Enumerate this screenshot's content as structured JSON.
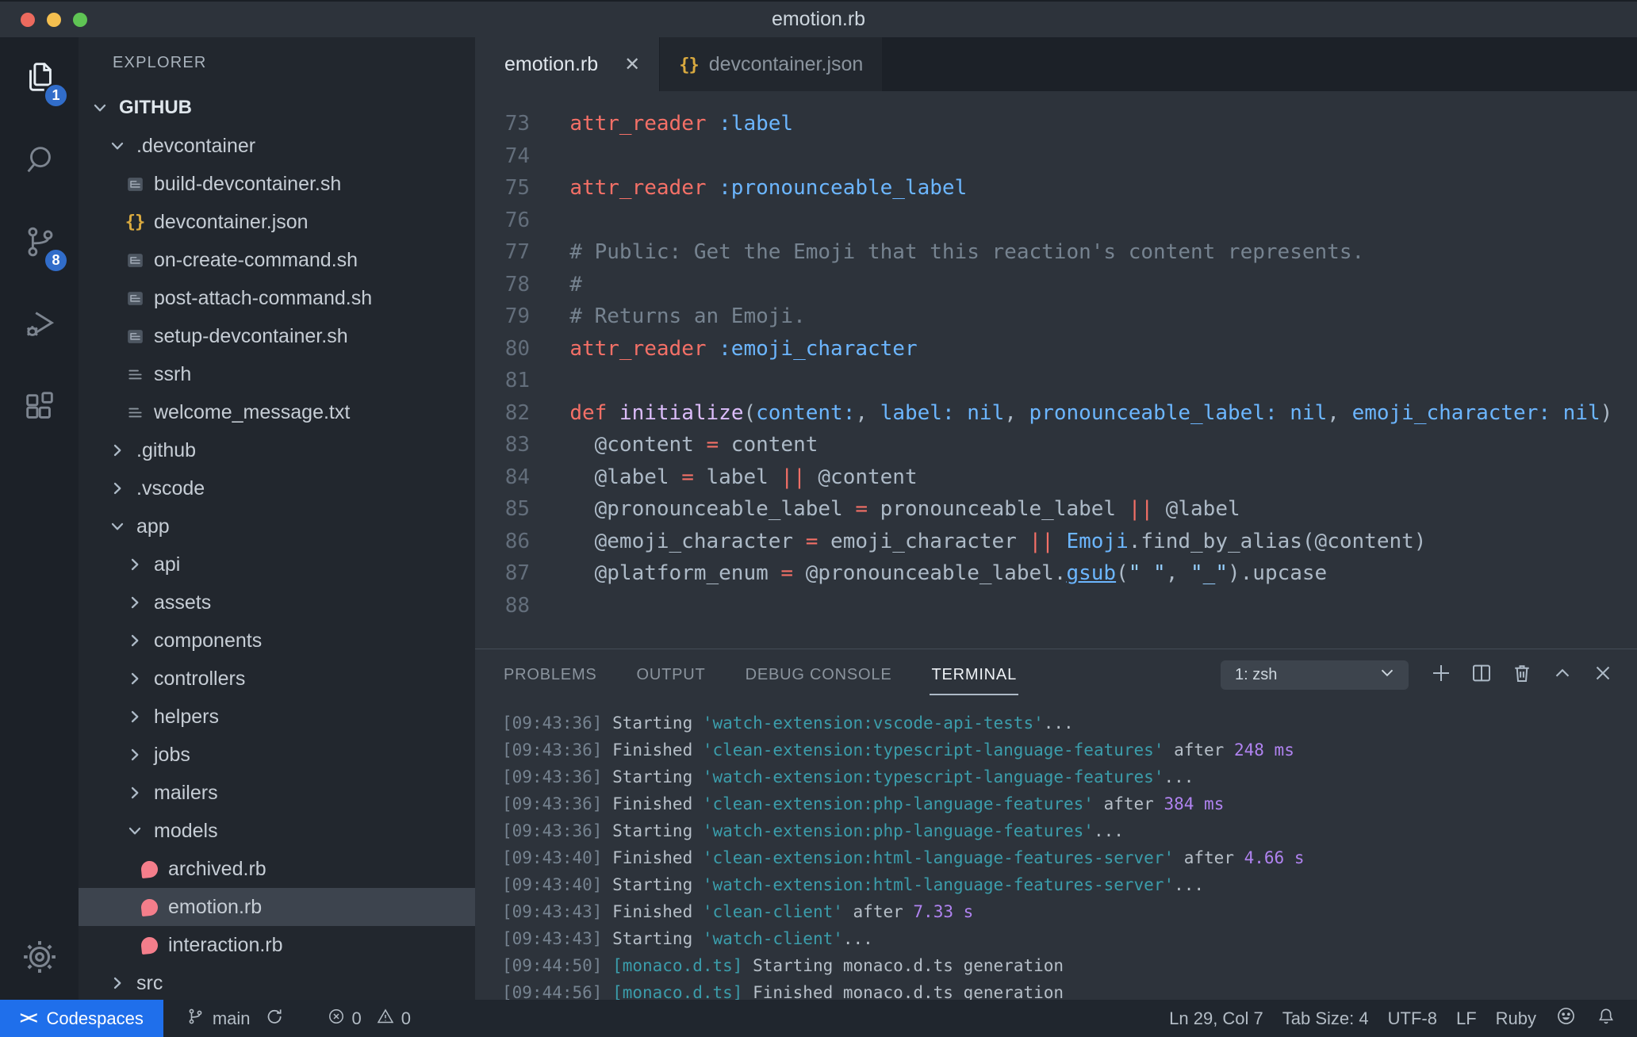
{
  "window": {
    "title": "emotion.rb"
  },
  "icons": {
    "tab_close": "✕",
    "remote_indicator": "><"
  },
  "activity_bar": {
    "items": [
      {
        "id": "explorer",
        "badge": "1",
        "active": true
      },
      {
        "id": "search",
        "badge": "",
        "active": false
      },
      {
        "id": "source-control",
        "badge": "8",
        "active": false
      },
      {
        "id": "run-debug",
        "badge": "",
        "active": false
      },
      {
        "id": "extensions",
        "badge": "",
        "active": false
      }
    ]
  },
  "sidebar": {
    "title": "EXPLORER",
    "tree": [
      {
        "label": "GITHUB",
        "level": 0,
        "kind": "folder",
        "expanded": true,
        "root": true
      },
      {
        "label": ".devcontainer",
        "level": 1,
        "kind": "folder",
        "expanded": true
      },
      {
        "label": "build-devcontainer.sh",
        "level": 2,
        "kind": "shell"
      },
      {
        "label": "devcontainer.json",
        "level": 2,
        "kind": "json"
      },
      {
        "label": "on-create-command.sh",
        "level": 2,
        "kind": "shell"
      },
      {
        "label": "post-attach-command.sh",
        "level": 2,
        "kind": "shell"
      },
      {
        "label": "setup-devcontainer.sh",
        "level": 2,
        "kind": "shell"
      },
      {
        "label": "ssrh",
        "level": 2,
        "kind": "text"
      },
      {
        "label": "welcome_message.txt",
        "level": 2,
        "kind": "text"
      },
      {
        "label": ".github",
        "level": 1,
        "kind": "folder",
        "expanded": false
      },
      {
        "label": ".vscode",
        "level": 1,
        "kind": "folder",
        "expanded": false
      },
      {
        "label": "app",
        "level": 1,
        "kind": "folder",
        "expanded": true
      },
      {
        "label": "api",
        "level": 2,
        "kind": "folder",
        "expanded": false
      },
      {
        "label": "assets",
        "level": 2,
        "kind": "folder",
        "expanded": false
      },
      {
        "label": "components",
        "level": 2,
        "kind": "folder",
        "expanded": false
      },
      {
        "label": "controllers",
        "level": 2,
        "kind": "folder",
        "expanded": false
      },
      {
        "label": "helpers",
        "level": 2,
        "kind": "folder",
        "expanded": false
      },
      {
        "label": "jobs",
        "level": 2,
        "kind": "folder",
        "expanded": false
      },
      {
        "label": "mailers",
        "level": 2,
        "kind": "folder",
        "expanded": false
      },
      {
        "label": "models",
        "level": 2,
        "kind": "folder",
        "expanded": true
      },
      {
        "label": "archived.rb",
        "level": 3,
        "kind": "ruby"
      },
      {
        "label": "emotion.rb",
        "level": 3,
        "kind": "ruby",
        "selected": true
      },
      {
        "label": "interaction.rb",
        "level": 3,
        "kind": "ruby"
      },
      {
        "label": "src",
        "level": 1,
        "kind": "folder",
        "expanded": false
      }
    ]
  },
  "editor": {
    "tabs": [
      {
        "label": "emotion.rb",
        "icon": "ruby-file-icon",
        "active": true,
        "close": "✕"
      },
      {
        "label": "devcontainer.json",
        "icon": "json-file-icon",
        "active": false
      }
    ],
    "lines": [
      {
        "num": "73",
        "segs": [
          [
            "  ",
            "plain"
          ],
          [
            "attr_reader",
            "red"
          ],
          [
            " ",
            "plain"
          ],
          [
            ":label",
            "blue"
          ]
        ]
      },
      {
        "num": "74",
        "segs": []
      },
      {
        "num": "75",
        "segs": [
          [
            "  ",
            "plain"
          ],
          [
            "attr_reader",
            "red"
          ],
          [
            " ",
            "plain"
          ],
          [
            ":pronounceable_label",
            "blue"
          ]
        ]
      },
      {
        "num": "76",
        "segs": []
      },
      {
        "num": "77",
        "segs": [
          [
            "  # Public: Get the Emoji that this reaction's content represents.",
            "comment"
          ]
        ]
      },
      {
        "num": "78",
        "segs": [
          [
            "  #",
            "comment"
          ]
        ]
      },
      {
        "num": "79",
        "segs": [
          [
            "  # Returns an Emoji.",
            "comment"
          ]
        ]
      },
      {
        "num": "80",
        "segs": [
          [
            "  ",
            "plain"
          ],
          [
            "attr_reader",
            "red"
          ],
          [
            " ",
            "plain"
          ],
          [
            ":emoji_character",
            "blue"
          ]
        ]
      },
      {
        "num": "81",
        "segs": []
      },
      {
        "num": "82",
        "segs": [
          [
            "  ",
            "plain"
          ],
          [
            "def",
            "red"
          ],
          [
            " ",
            "plain"
          ],
          [
            "initialize",
            "purple"
          ],
          [
            "(",
            "plain"
          ],
          [
            "content:",
            "blue"
          ],
          [
            ", ",
            "plain"
          ],
          [
            "label:",
            "blue"
          ],
          [
            " ",
            "plain"
          ],
          [
            "nil",
            "blue"
          ],
          [
            ", ",
            "plain"
          ],
          [
            "pronounceable_label:",
            "blue"
          ],
          [
            " ",
            "plain"
          ],
          [
            "nil",
            "blue"
          ],
          [
            ", ",
            "plain"
          ],
          [
            "emoji_character:",
            "blue"
          ],
          [
            " ",
            "plain"
          ],
          [
            "nil",
            "blue"
          ],
          [
            ")",
            "plain"
          ]
        ]
      },
      {
        "num": "83",
        "segs": [
          [
            "    @content ",
            "plain"
          ],
          [
            "=",
            "red"
          ],
          [
            " content",
            "plain"
          ]
        ]
      },
      {
        "num": "84",
        "segs": [
          [
            "    @label ",
            "plain"
          ],
          [
            "=",
            "red"
          ],
          [
            " label ",
            "plain"
          ],
          [
            "||",
            "red"
          ],
          [
            " @content",
            "plain"
          ]
        ]
      },
      {
        "num": "85",
        "segs": [
          [
            "    @pronounceable_label ",
            "plain"
          ],
          [
            "=",
            "red"
          ],
          [
            " pronounceable_label ",
            "plain"
          ],
          [
            "||",
            "red"
          ],
          [
            " @label",
            "plain"
          ]
        ]
      },
      {
        "num": "86",
        "segs": [
          [
            "    @emoji_character ",
            "plain"
          ],
          [
            "=",
            "red"
          ],
          [
            " emoji_character ",
            "plain"
          ],
          [
            "||",
            "red"
          ],
          [
            " ",
            "plain"
          ],
          [
            "Emoji",
            "blue"
          ],
          [
            ".find_by_alias(@content)",
            "plain"
          ]
        ]
      },
      {
        "num": "87",
        "segs": [
          [
            "    @platform_enum ",
            "plain"
          ],
          [
            "=",
            "red"
          ],
          [
            " @pronounceable_label.",
            "plain"
          ],
          [
            "gsub",
            "fn"
          ],
          [
            "(",
            "plain"
          ],
          [
            "\" \"",
            "str"
          ],
          [
            ", ",
            "plain"
          ],
          [
            "\"_\"",
            "str"
          ],
          [
            ")",
            "plain"
          ],
          [
            ".upcase",
            "plain"
          ]
        ]
      },
      {
        "num": "88",
        "segs": []
      }
    ]
  },
  "panel": {
    "tabs": [
      {
        "label": "PROBLEMS",
        "active": false
      },
      {
        "label": "OUTPUT",
        "active": false
      },
      {
        "label": "DEBUG CONSOLE",
        "active": false
      },
      {
        "label": "TERMINAL",
        "active": true
      }
    ],
    "terminal_select": "1: zsh",
    "lines": [
      [
        [
          "[09:43:36] ",
          "time"
        ],
        [
          "Starting ",
          "plain"
        ],
        [
          "'watch-extension:vscode-api-tests'",
          "task"
        ],
        [
          "...",
          "plain"
        ]
      ],
      [
        [
          "[09:43:36] ",
          "time"
        ],
        [
          "Finished ",
          "plain"
        ],
        [
          "'clean-extension:typescript-language-features'",
          "task"
        ],
        [
          " after ",
          "plain"
        ],
        [
          "248 ms",
          "dur"
        ]
      ],
      [
        [
          "[09:43:36] ",
          "time"
        ],
        [
          "Starting ",
          "plain"
        ],
        [
          "'watch-extension:typescript-language-features'",
          "task"
        ],
        [
          "...",
          "plain"
        ]
      ],
      [
        [
          "[09:43:36] ",
          "time"
        ],
        [
          "Finished ",
          "plain"
        ],
        [
          "'clean-extension:php-language-features'",
          "task"
        ],
        [
          " after ",
          "plain"
        ],
        [
          "384 ms",
          "dur"
        ]
      ],
      [
        [
          "[09:43:36] ",
          "time"
        ],
        [
          "Starting ",
          "plain"
        ],
        [
          "'watch-extension:php-language-features'",
          "task"
        ],
        [
          "...",
          "plain"
        ]
      ],
      [
        [
          "[09:43:40] ",
          "time"
        ],
        [
          "Finished ",
          "plain"
        ],
        [
          "'clean-extension:html-language-features-server'",
          "task"
        ],
        [
          " after ",
          "plain"
        ],
        [
          "4.66 s",
          "dur"
        ]
      ],
      [
        [
          "[09:43:40] ",
          "time"
        ],
        [
          "Starting ",
          "plain"
        ],
        [
          "'watch-extension:html-language-features-server'",
          "task"
        ],
        [
          "...",
          "plain"
        ]
      ],
      [
        [
          "[09:43:43] ",
          "time"
        ],
        [
          "Finished ",
          "plain"
        ],
        [
          "'clean-client'",
          "task"
        ],
        [
          " after ",
          "plain"
        ],
        [
          "7.33 s",
          "dur"
        ]
      ],
      [
        [
          "[09:43:43] ",
          "time"
        ],
        [
          "Starting ",
          "plain"
        ],
        [
          "'watch-client'",
          "task"
        ],
        [
          "...",
          "plain"
        ]
      ],
      [
        [
          "[09:44:50] ",
          "time"
        ],
        [
          "[monaco.d.ts] ",
          "task"
        ],
        [
          "Starting monaco.d.ts generation",
          "plain"
        ]
      ],
      [
        [
          "[09:44:56] ",
          "time"
        ],
        [
          "[monaco.d.ts] ",
          "task"
        ],
        [
          "Finished monaco.d.ts generation",
          "plain"
        ]
      ]
    ]
  },
  "status_bar": {
    "codespaces_label": "Codespaces",
    "branch_label": "main",
    "errors": "0",
    "warnings": "0",
    "cursor": "Ln 29, Col 7",
    "tab_size": "Tab Size: 4",
    "encoding": "UTF-8",
    "eol": "LF",
    "language": "Ruby"
  },
  "colors": {
    "accent_blue": "#316dca",
    "statusbar_remote": "#1f6feb",
    "editor_bg": "#2d333b",
    "sidebar_bg": "#22272e",
    "activitybar_bg": "#1c2128",
    "ruby_pink": "#f47e8b",
    "json_yellow": "#daaa3f",
    "terminal_task": "#3b9dab",
    "terminal_duration": "#b083f0"
  }
}
